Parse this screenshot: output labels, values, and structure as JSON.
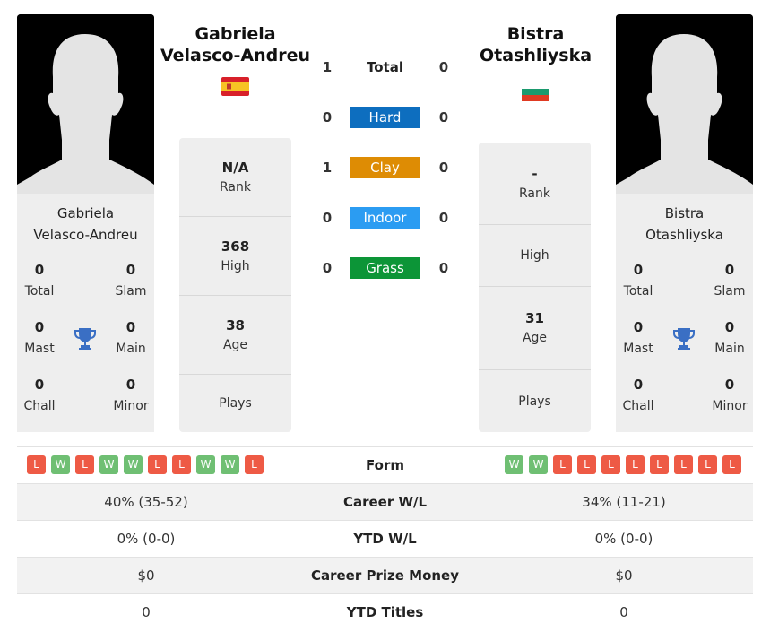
{
  "player1": {
    "name": "Gabriela Velasco-Andreu",
    "name_line1": "Gabriela",
    "name_line2": "Velasco-Andreu",
    "country_flag": "spain-flag",
    "titles": {
      "total": {
        "value": "0",
        "label": "Total"
      },
      "slam": {
        "value": "0",
        "label": "Slam"
      },
      "mast": {
        "value": "0",
        "label": "Mast"
      },
      "main": {
        "value": "0",
        "label": "Main"
      },
      "chall": {
        "value": "0",
        "label": "Chall"
      },
      "minor": {
        "value": "0",
        "label": "Minor"
      }
    },
    "info": {
      "rank": {
        "value": "N/A",
        "label": "Rank"
      },
      "high": {
        "value": "368",
        "label": "High"
      },
      "age": {
        "value": "38",
        "label": "Age"
      },
      "plays": {
        "value": "",
        "label": "Plays"
      }
    },
    "form": [
      "L",
      "W",
      "L",
      "W",
      "W",
      "L",
      "L",
      "W",
      "W",
      "L"
    ],
    "career_wl": "40% (35-52)",
    "ytd_wl": "0% (0-0)",
    "career_prize": "$0",
    "ytd_titles": "0"
  },
  "player2": {
    "name": "Bistra Otashliyska",
    "name_line1": "Bistra",
    "name_line2": "Otashliyska",
    "country_flag": "bulgaria-flag",
    "titles": {
      "total": {
        "value": "0",
        "label": "Total"
      },
      "slam": {
        "value": "0",
        "label": "Slam"
      },
      "mast": {
        "value": "0",
        "label": "Mast"
      },
      "main": {
        "value": "0",
        "label": "Main"
      },
      "chall": {
        "value": "0",
        "label": "Chall"
      },
      "minor": {
        "value": "0",
        "label": "Minor"
      }
    },
    "info": {
      "rank": {
        "value": "-",
        "label": "Rank"
      },
      "high": {
        "value": "",
        "label": "High"
      },
      "age": {
        "value": "31",
        "label": "Age"
      },
      "plays": {
        "value": "",
        "label": "Plays"
      }
    },
    "form": [
      "W",
      "W",
      "L",
      "L",
      "L",
      "L",
      "L",
      "L",
      "L",
      "L"
    ],
    "career_wl": "34% (11-21)",
    "ytd_wl": "0% (0-0)",
    "career_prize": "$0",
    "ytd_titles": "0"
  },
  "h2h": [
    {
      "label": "Total",
      "p1": "1",
      "p2": "0",
      "color": ""
    },
    {
      "label": "Hard",
      "p1": "0",
      "p2": "0",
      "color": "#0d6ebf"
    },
    {
      "label": "Clay",
      "p1": "1",
      "p2": "0",
      "color": "#de8c04"
    },
    {
      "label": "Indoor",
      "p1": "0",
      "p2": "0",
      "color": "#2b9cf2"
    },
    {
      "label": "Grass",
      "p1": "0",
      "p2": "0",
      "color": "#0c9537"
    }
  ],
  "comparison": {
    "form_label": "Form",
    "career_wl_label": "Career W/L",
    "ytd_wl_label": "YTD W/L",
    "career_prize_label": "Career Prize Money",
    "ytd_titles_label": "YTD Titles"
  },
  "colors": {
    "win": "#6fbf73",
    "loss": "#ee5a45",
    "trophy": "#3a6fc4"
  }
}
